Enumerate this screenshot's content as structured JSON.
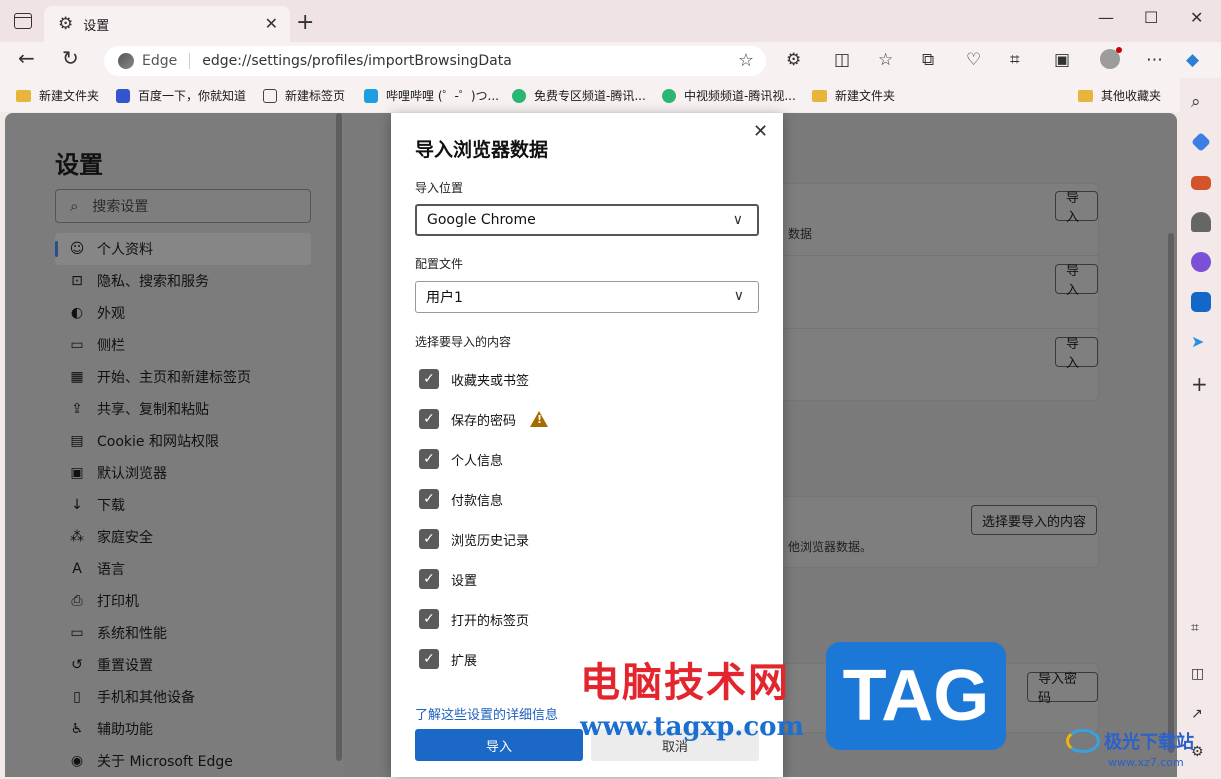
{
  "tab": {
    "title": "设置"
  },
  "address": {
    "site": "Edge",
    "url": "edge://settings/profiles/importBrowsingData"
  },
  "favorites": [
    {
      "label": "新建文件夹",
      "type": "folder"
    },
    {
      "label": "百度一下，你就知道",
      "type": "baidu"
    },
    {
      "label": "新建标签页",
      "type": "page"
    },
    {
      "label": "哔哩哔哩 (゜-゜)つ...",
      "type": "bili"
    },
    {
      "label": "免费专区频道-腾讯...",
      "type": "video"
    },
    {
      "label": "中视频频道-腾讯视...",
      "type": "video"
    },
    {
      "label": "新建文件夹",
      "type": "folder"
    }
  ],
  "favorites_other": "其他收藏夹",
  "settings": {
    "title": "设置",
    "search_placeholder": "搜索设置",
    "nav": [
      {
        "label": "个人资料",
        "icon": "profile-icon",
        "active": true
      },
      {
        "label": "隐私、搜索和服务",
        "icon": "lock-icon"
      },
      {
        "label": "外观",
        "icon": "palette-icon"
      },
      {
        "label": "侧栏",
        "icon": "sidebar-icon"
      },
      {
        "label": "开始、主页和新建标签页",
        "icon": "home-icon"
      },
      {
        "label": "共享、复制和粘贴",
        "icon": "share-icon"
      },
      {
        "label": "Cookie 和网站权限",
        "icon": "cookie-icon"
      },
      {
        "label": "默认浏览器",
        "icon": "browser-icon"
      },
      {
        "label": "下载",
        "icon": "download-icon"
      },
      {
        "label": "家庭安全",
        "icon": "family-icon"
      },
      {
        "label": "语言",
        "icon": "language-icon"
      },
      {
        "label": "打印机",
        "icon": "printer-icon"
      },
      {
        "label": "系统和性能",
        "icon": "system-icon"
      },
      {
        "label": "重置设置",
        "icon": "reset-icon"
      },
      {
        "label": "手机和其他设备",
        "icon": "phone-icon"
      },
      {
        "label": "辅助功能",
        "icon": "accessibility-icon"
      },
      {
        "label": "关于 Microsoft Edge",
        "icon": "edge-icon"
      }
    ]
  },
  "background": {
    "import_btn": "导入",
    "data_text": "数据",
    "choose_btn": "选择要导入的内容",
    "other_browser_text": "他浏览器数据。",
    "import_password_btn": "导入密码"
  },
  "dialog": {
    "title": "导入浏览器数据",
    "source_label": "导入位置",
    "source_value": "Google Chrome",
    "profile_label": "配置文件",
    "profile_value": "用户1",
    "content_label": "选择要导入的内容",
    "items": [
      {
        "label": "收藏夹或书签",
        "checked": true
      },
      {
        "label": "保存的密码",
        "checked": true,
        "warning": true
      },
      {
        "label": "个人信息",
        "checked": true
      },
      {
        "label": "付款信息",
        "checked": true
      },
      {
        "label": "浏览历史记录",
        "checked": true
      },
      {
        "label": "设置",
        "checked": true
      },
      {
        "label": "打开的标签页",
        "checked": true
      },
      {
        "label": "扩展",
        "checked": true
      }
    ],
    "learn_more": "了解这些设置的详细信息",
    "import_btn": "导入",
    "cancel_btn": "取消"
  },
  "watermark": {
    "cn": "电脑技术网",
    "url": "www.tagxp.com",
    "tag": "TAG",
    "logo": "极光下载站",
    "logo_sub": "www.xz7.com"
  }
}
